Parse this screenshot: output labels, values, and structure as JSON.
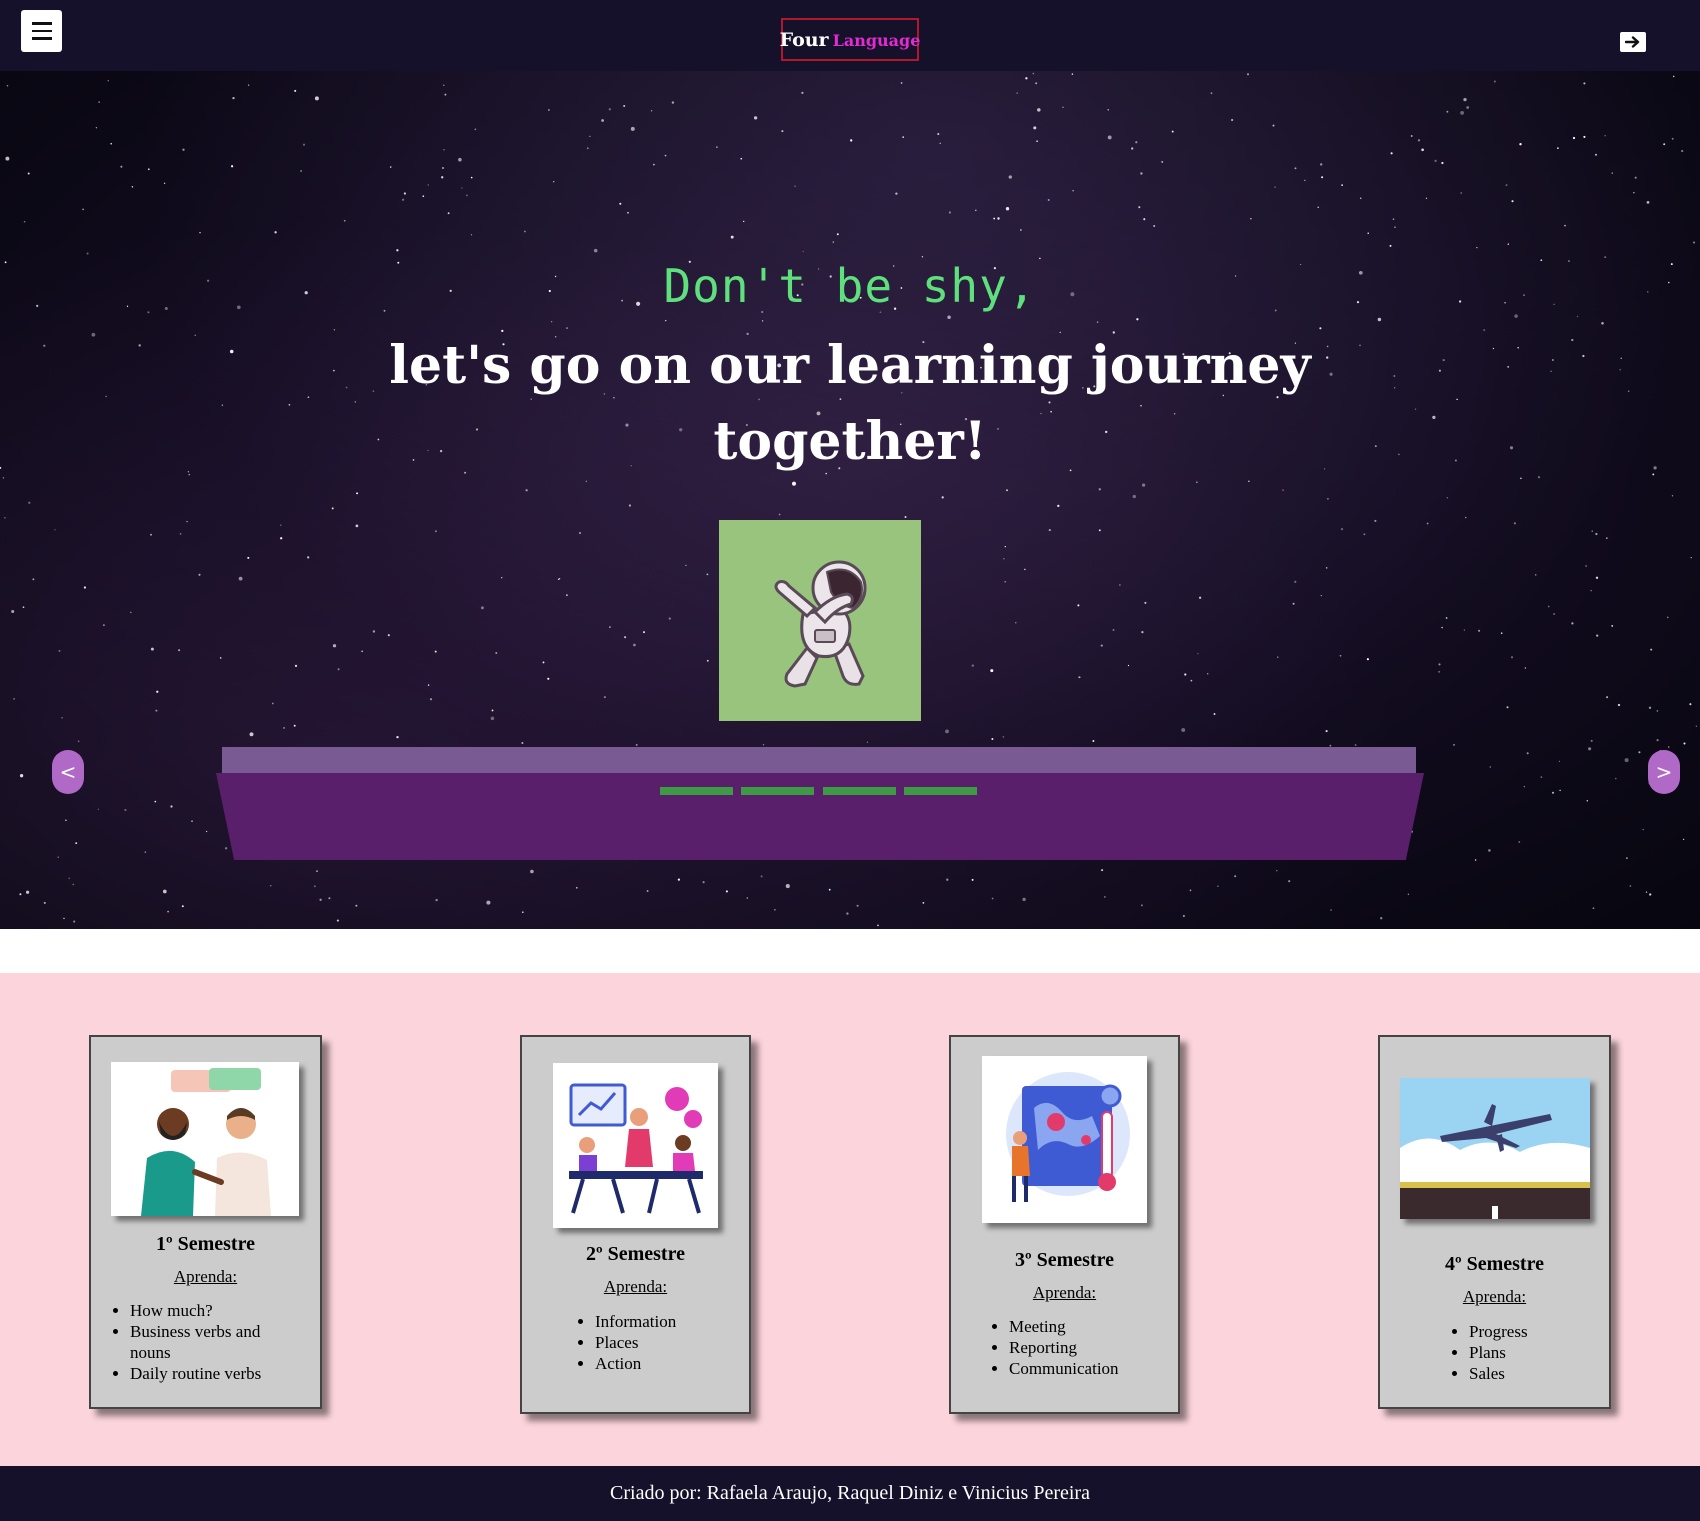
{
  "header": {
    "brand_part1": "Four",
    "brand_part2": "Language"
  },
  "hero": {
    "line1": "Don't be shy,",
    "line2": "let's go on our learning journey",
    "line3": "together!",
    "prev_label": "<",
    "next_label": ">"
  },
  "semesters": [
    {
      "title": "1º Semestre",
      "subtitle": "Aprenda:",
      "items": [
        "How much?",
        "Business verbs and nouns",
        "Daily routine verbs"
      ]
    },
    {
      "title": "2º Semestre",
      "subtitle": "Aprenda:",
      "items": [
        "Information",
        "Places",
        "Action"
      ]
    },
    {
      "title": "3º Semestre",
      "subtitle": "Aprenda:",
      "items": [
        "Meeting",
        "Reporting",
        "Communication"
      ]
    },
    {
      "title": "4º Semestre",
      "subtitle": "Aprenda:",
      "items": [
        "Progress",
        "Plans",
        "Sales"
      ]
    }
  ],
  "footer": {
    "credits": "Criado por: Rafaela Araujo, Raquel Diniz e Vinicius Pereira"
  },
  "colors": {
    "nav_bg": "#15112a",
    "accent_green": "#5ee07c",
    "brand_pink": "#e42ad1",
    "section_pink": "#fcd5dc",
    "shelf_purple": "#5a1f6a"
  }
}
